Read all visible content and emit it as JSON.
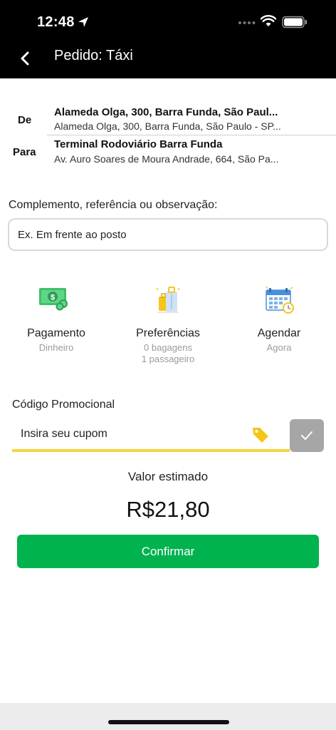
{
  "status": {
    "time": "12:48"
  },
  "header": {
    "title": "Pedido: Táxi"
  },
  "route": {
    "from_label": "De",
    "from_main": "Alameda Olga, 300, Barra Funda, São Paul...",
    "from_sub": "Alameda Olga, 300, Barra Funda, São Paulo - SP...",
    "to_label": "Para",
    "to_main": "Terminal Rodoviário Barra Funda",
    "to_sub": "Av. Auro Soares de Moura Andrade, 664, São Pa..."
  },
  "complement": {
    "label": "Complemento, referência ou observação:",
    "placeholder": "Ex. Em frente ao posto"
  },
  "options": {
    "payment": {
      "title": "Pagamento",
      "sub": "Dinheiro"
    },
    "preferences": {
      "title": "Preferências",
      "sub1": "0 bagagens",
      "sub2": "1 passageiro"
    },
    "schedule": {
      "title": "Agendar",
      "sub": "Agora"
    }
  },
  "promo": {
    "label": "Código Promocional",
    "placeholder": "Insira seu cupom"
  },
  "estimate": {
    "label": "Valor estimado",
    "value": "R$21,80"
  },
  "confirm_label": "Confirmar",
  "colors": {
    "accent": "#00b34f",
    "underline": "#f5d63a",
    "tag": "#f5c518",
    "header": "#000000"
  }
}
